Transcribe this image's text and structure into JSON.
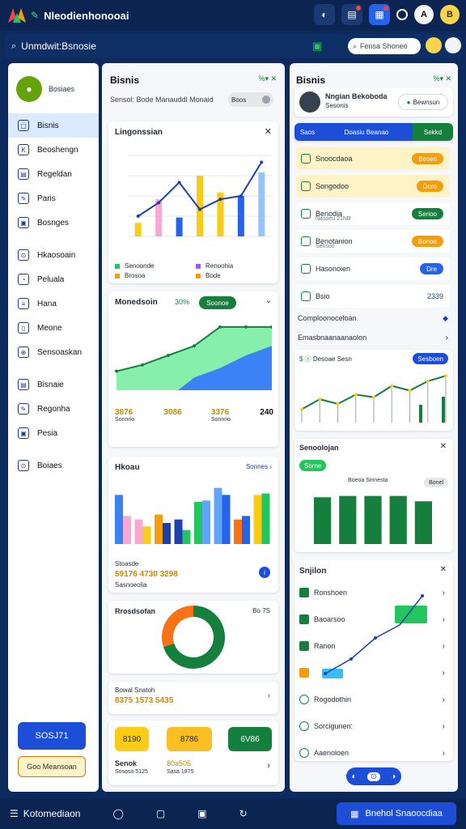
{
  "topbar": {
    "title": "Nleodienhonooai",
    "icons": [
      "folder-icon",
      "grid-icon",
      "circle-icon"
    ],
    "avatar1": "A",
    "avatar2": "B"
  },
  "subbar": {
    "title": "Unmdwit:Bsnosie",
    "search": "Fensa Shoneo"
  },
  "sidebar": {
    "profile_name": "Bosiaes",
    "items": [
      "Bisnis",
      "Beoshengn",
      "Regeldan",
      "Paris",
      "Bosnges",
      "Hkaosoain",
      "Peluala",
      "Hana",
      "Meone",
      "Sensoaskan",
      "Bisnaie",
      "Regonha",
      "Pesia",
      "Boiaes"
    ],
    "button1": "SOSJ71",
    "button2": "Goo Meansoan"
  },
  "col1": {
    "title": "Bisnis",
    "close": "✕",
    "search_label": "Sensol: Bode Manauddl Monaid",
    "search_pill": "Boos",
    "chart1": {
      "title": "Lingonssian",
      "legend1": "Senoonde",
      "legend2": "Brosoa",
      "legend3": "Renoohia",
      "legend4": "Bode"
    },
    "chart2": {
      "title": "Monedsoin",
      "pct": "30%",
      "btn": "Soonoe",
      "stats": [
        {
          "label": "Sonnrio",
          "value": "3876"
        },
        {
          "label": "",
          "value": "3086"
        },
        {
          "label": "Sonnrio",
          "value": "3376"
        },
        {
          "label": "",
          "value": "240"
        }
      ]
    },
    "chart3": {
      "title": "Hkoau",
      "sub": "Sonnes",
      "total_label": "Stoasde",
      "total_value": "59176 4730 3298",
      "footer": "Sasnoeolia"
    },
    "donut": {
      "title": "Rrosdsofan",
      "value": "Bo 7S"
    },
    "status": {
      "label": "Bowal Snatoh",
      "value": "8375 1573 5435"
    },
    "cards": [
      {
        "value": "8190"
      },
      {
        "value": "8786"
      },
      {
        "value": "6V86"
      }
    ],
    "footer": {
      "left": "Senok",
      "left_sub": "Sososo 5125",
      "mid": "80a505",
      "mid_sub": "Sasa 1875"
    }
  },
  "col2": {
    "title": "Bisnis",
    "profile": {
      "name": "Nngian Bekoboda",
      "role": "Sesonis"
    },
    "profile_btn": "Bewnsun",
    "tabs": [
      "Saos",
      "Doasiu Beanao",
      "Sekkd"
    ],
    "rows": [
      {
        "label": "Snoocdaoa",
        "badge": "Besen",
        "color": "#f59e0b"
      },
      {
        "label": "Songodoo",
        "badge": "Doro",
        "color": "#f59e0b"
      },
      {
        "label": "Benodia",
        "sub": "Nasoeu 21NB",
        "badge": "Serioo",
        "color": "#15803d"
      },
      {
        "label": "Benotanion",
        "sub": "Sensoo",
        "badge": "Bonoo",
        "color": "#f59e0b"
      },
      {
        "label": "Hasonoien",
        "badge": "Dre",
        "color": "#2563eb"
      },
      {
        "label": "Bsio",
        "value": "2339"
      }
    ],
    "links": [
      "Comploonoceloan",
      "Emasbnaanaanaolon"
    ],
    "chart4": {
      "title": "Desoae Sesn",
      "badge": "Sesboen"
    },
    "bars_panel": {
      "title": "Senoolojan",
      "tag": "Sorne",
      "legend": "Boeoa Sinnesta",
      "pill": "Bonel"
    },
    "timeline": {
      "title": "Snjilon",
      "rows": [
        "Ronshoen",
        "Baoarsoo",
        "Ranon",
        "",
        "Rogodothin",
        "Sorcigunen:",
        "Aaenoloen"
      ]
    }
  },
  "bottombar": {
    "left": "Kotomediaon",
    "main": "Bnehol Snaoocdiaa"
  },
  "chart_data": [
    {
      "type": "bar",
      "categories": [
        "1",
        "2",
        "3",
        "4",
        "5",
        "6",
        "7"
      ],
      "values": [
        20,
        55,
        28,
        90,
        65,
        60,
        95
      ],
      "colors": [
        "#facc15",
        "#f9a8d4",
        "#2563eb",
        "#facc15",
        "#facc15",
        "#2563eb",
        "#93c5fd"
      ],
      "line": [
        30,
        50,
        80,
        40,
        55,
        60,
        110
      ],
      "ylim": [
        0,
        120
      ]
    },
    {
      "type": "area",
      "series": [
        {
          "name": "a",
          "values": [
            30,
            40,
            55,
            70,
            100,
            100,
            100
          ]
        },
        {
          "name": "b",
          "values": [
            0,
            0,
            0,
            20,
            35,
            55,
            70
          ]
        }
      ],
      "ylim": [
        0,
        110
      ]
    },
    {
      "type": "bar",
      "categories": [
        "a",
        "b",
        "c",
        "d",
        "e",
        "f",
        "g",
        "h"
      ],
      "values": [
        70,
        35,
        42,
        35,
        60,
        80,
        35,
        70
      ],
      "values2": [
        40,
        25,
        30,
        20,
        62,
        70,
        40,
        72
      ],
      "ylim": [
        0,
        90
      ]
    },
    {
      "type": "pie",
      "values": [
        70,
        30
      ]
    },
    {
      "type": "line",
      "values": [
        20,
        35,
        28,
        42,
        38,
        55,
        48,
        62,
        70
      ],
      "ylim": [
        0,
        80
      ]
    },
    {
      "type": "bar",
      "values": [
        70,
        72,
        72,
        72,
        64
      ],
      "ylim": [
        0,
        80
      ]
    }
  ]
}
